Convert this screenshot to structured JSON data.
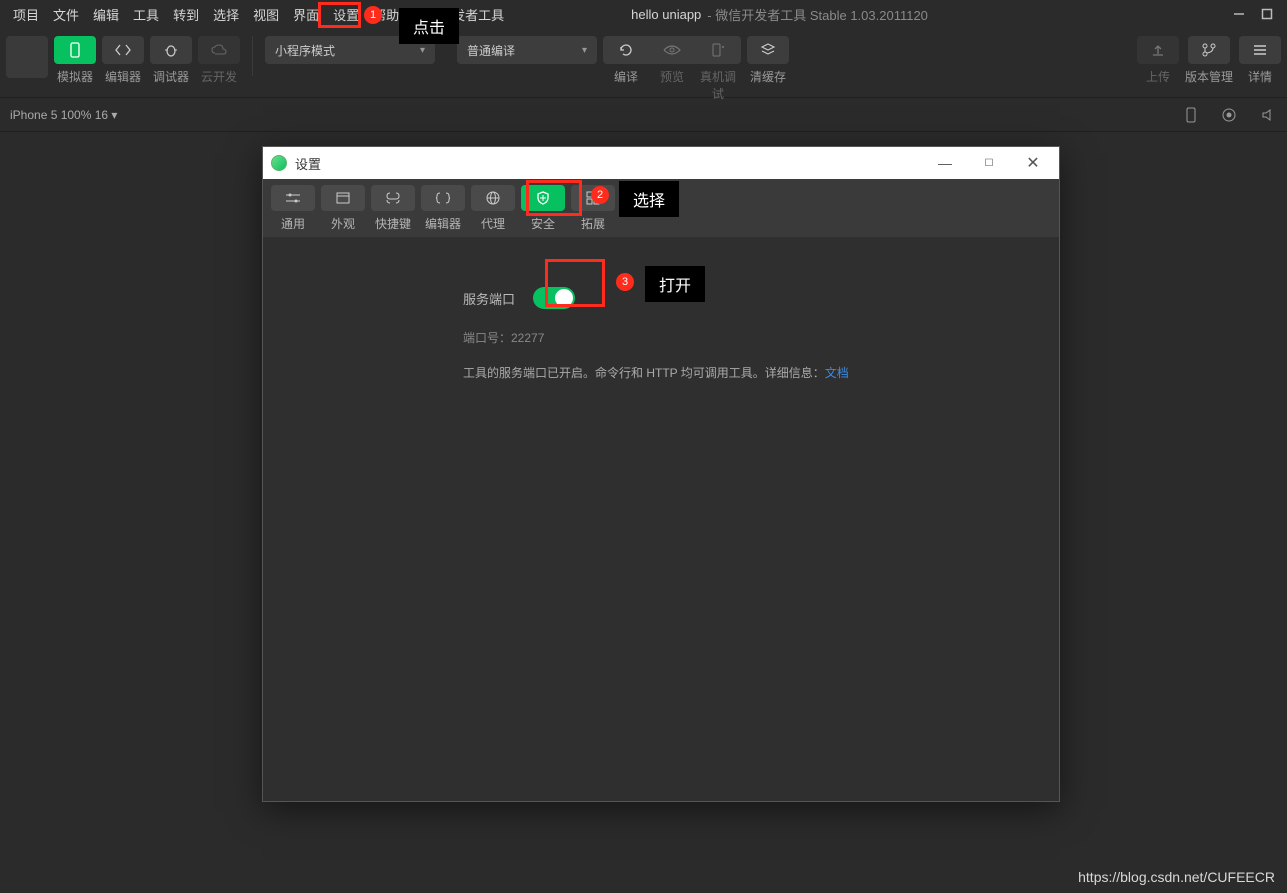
{
  "menubar": {
    "items": [
      "项目",
      "文件",
      "编辑",
      "工具",
      "转到",
      "选择",
      "视图",
      "界面",
      "设置",
      "帮助",
      "微信开发者工具"
    ],
    "app_title": "hello uniapp",
    "app_subtitle": " - 微信开发者工具 Stable 1.03.2011120"
  },
  "toolbar": {
    "simulator": "模拟器",
    "editor": "编辑器",
    "debugger": "调试器",
    "cloud": "云开发",
    "mode_select": "小程序模式",
    "compile_select": "普通编译",
    "compile": "编译",
    "preview": "预览",
    "remote": "真机调试",
    "cache": "清缓存",
    "upload": "上传",
    "version": "版本管理",
    "details": "详情"
  },
  "devicebar": {
    "label": "iPhone 5 100% 16 ▾"
  },
  "dialog": {
    "title": "设置",
    "tabs": [
      "通用",
      "外观",
      "快捷键",
      "编辑器",
      "代理",
      "安全",
      "拓展"
    ],
    "port_label": "服务端口",
    "port_line": "端口号：22277",
    "desc_prefix": "工具的服务端口已开启。命令行和 HTTP 均可调用工具。详细信息：",
    "desc_link": "文档"
  },
  "annotations": {
    "b1": "1",
    "b2": "2",
    "b3": "3",
    "t1": "点击",
    "t2": "选择",
    "t3": "打开"
  },
  "watermark": "https://blog.csdn.net/CUFEECR"
}
